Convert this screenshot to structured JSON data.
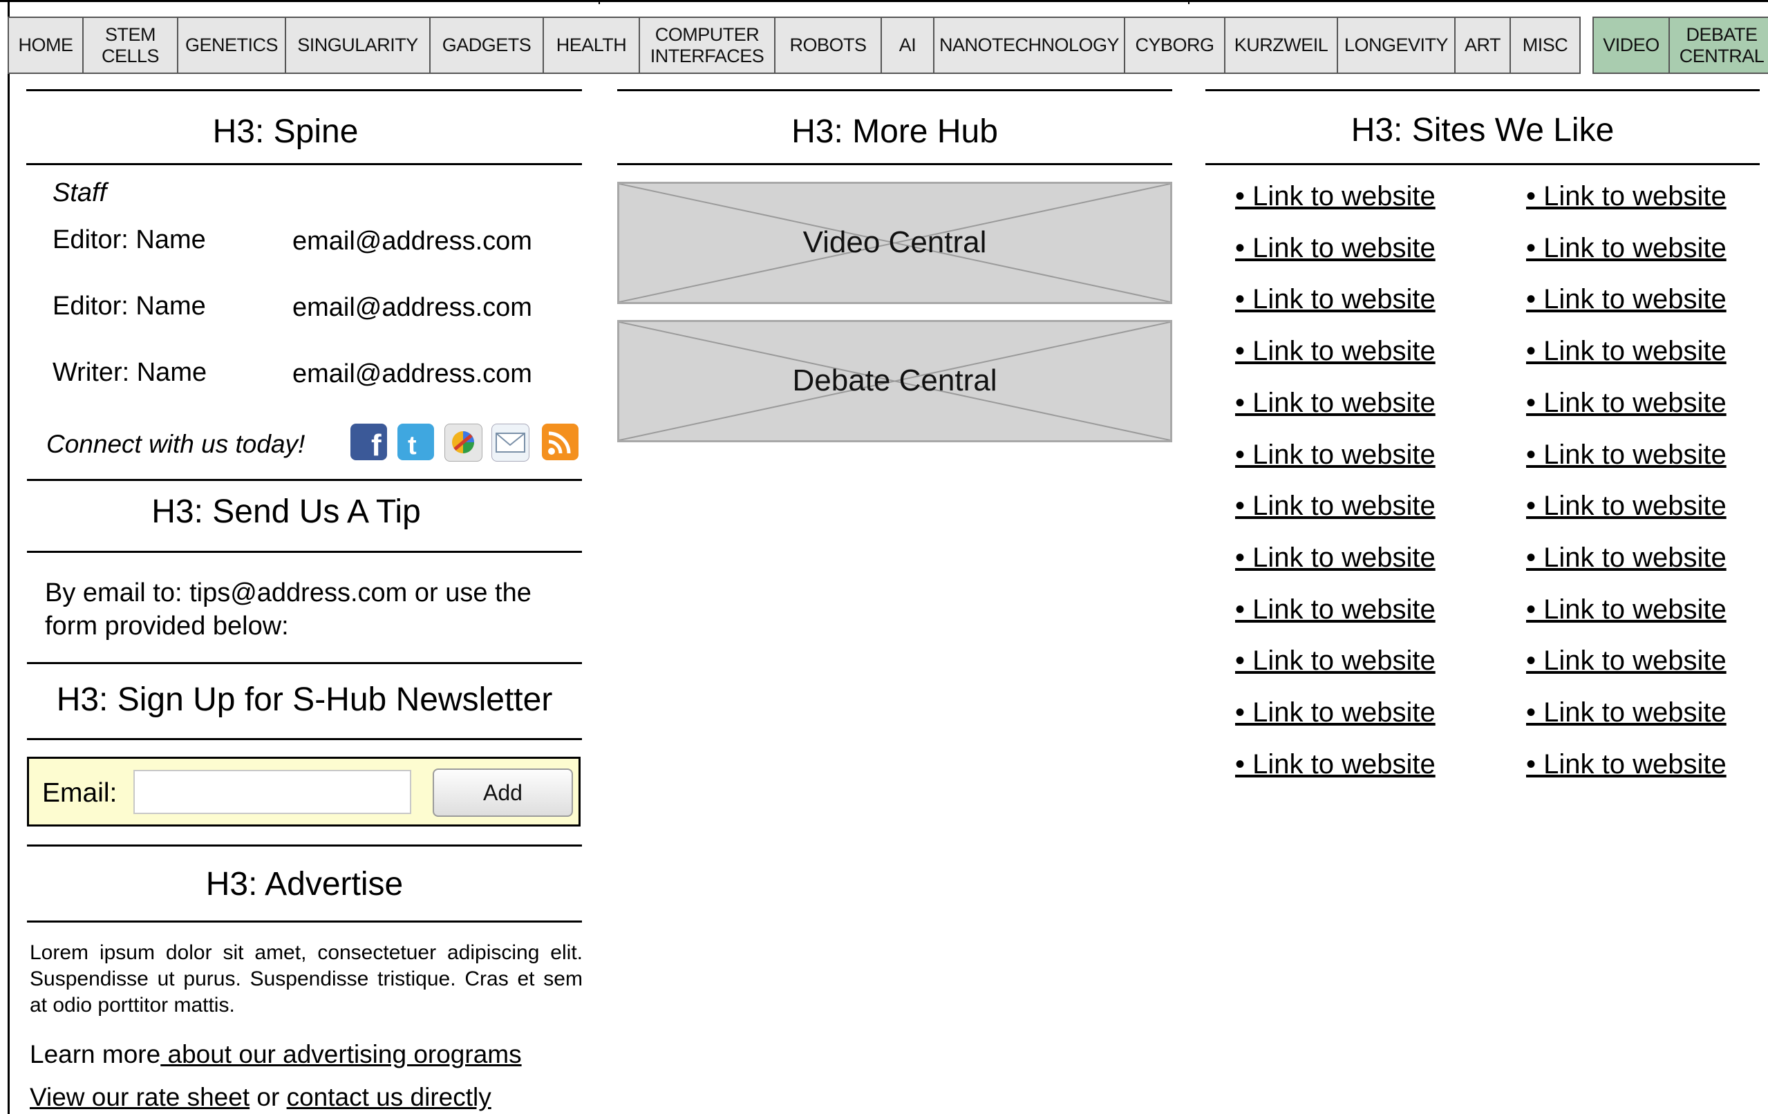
{
  "nav": {
    "items": [
      {
        "label": "HOME"
      },
      {
        "label": "STEM\nCELLS"
      },
      {
        "label": "GENETICS"
      },
      {
        "label": "SINGULARITY"
      },
      {
        "label": "GADGETS"
      },
      {
        "label": "HEALTH"
      },
      {
        "label": "COMPUTER\nINTERFACES"
      },
      {
        "label": "ROBOTS"
      },
      {
        "label": "AI"
      },
      {
        "label": "NANOTECHNOLOGY"
      },
      {
        "label": "CYBORG"
      },
      {
        "label": "KURZWEIL"
      },
      {
        "label": "LONGEVITY"
      },
      {
        "label": "ART"
      },
      {
        "label": "MISC"
      }
    ],
    "right_items": [
      {
        "label": "VIDEO"
      },
      {
        "label": "DEBATE\nCENTRAL"
      }
    ],
    "right_color": "#a9ccaf"
  },
  "spine": {
    "title": "H3: Spine",
    "staff_heading": "Staff",
    "staff": [
      {
        "role": "Editor: Name",
        "email": "email@address.com"
      },
      {
        "role": "Editor: Name",
        "email": "email@address.com"
      },
      {
        "role": "Writer: Name",
        "email": "email@address.com"
      }
    ],
    "connect_text": "Connect with us today!",
    "social_icons": [
      "facebook-icon",
      "twitter-icon",
      "google-buzz-icon",
      "mail-icon",
      "rss-icon"
    ]
  },
  "tip": {
    "title": "H3: Send Us A Tip",
    "text": "By email to: tips@address.com or use the form provided below:"
  },
  "newsletter": {
    "title": "H3: Sign Up for S-Hub Newsletter",
    "email_label": "Email:",
    "email_value": "",
    "button_label": "Add",
    "box_color": "#fdfcd0"
  },
  "advertise": {
    "title": "H3: Advertise",
    "body": "Lorem ipsum dolor sit amet, consectetuer adipiscing elit. Suspendisse ut purus. Suspendisse tristique. Cras et sem at odio porttitor mattis.",
    "learn_prefix": "Learn more",
    "learn_link": " about our advertising orograms",
    "rate_link": "View our rate sheet",
    "or_text": " or ",
    "contact_link": "contact us directly"
  },
  "more_hub": {
    "title": "H3: More Hub",
    "tiles": [
      {
        "label": "Video Central"
      },
      {
        "label": "Debate Central"
      }
    ]
  },
  "sites": {
    "title": "H3: Sites We Like",
    "link_text": "• Link to website",
    "rows": 12,
    "columns": 2
  }
}
